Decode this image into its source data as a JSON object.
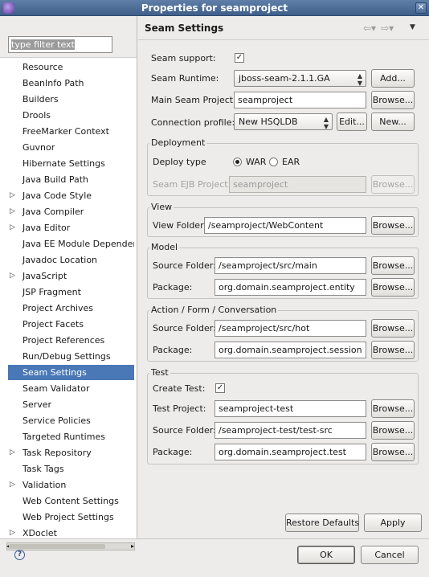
{
  "window": {
    "title": "Properties for seamproject",
    "close_glyph": "✕"
  },
  "filter": {
    "value": "type filter text"
  },
  "tree": {
    "items": [
      {
        "label": "Resource",
        "expandable": false
      },
      {
        "label": "BeanInfo Path",
        "expandable": false
      },
      {
        "label": "Builders",
        "expandable": false
      },
      {
        "label": "Drools",
        "expandable": false
      },
      {
        "label": "FreeMarker Context",
        "expandable": false
      },
      {
        "label": "Guvnor",
        "expandable": false
      },
      {
        "label": "Hibernate Settings",
        "expandable": false
      },
      {
        "label": "Java Build Path",
        "expandable": false
      },
      {
        "label": "Java Code Style",
        "expandable": true
      },
      {
        "label": "Java Compiler",
        "expandable": true
      },
      {
        "label": "Java Editor",
        "expandable": true
      },
      {
        "label": "Java EE Module Dependencies",
        "expandable": false
      },
      {
        "label": "Javadoc Location",
        "expandable": false
      },
      {
        "label": "JavaScript",
        "expandable": true
      },
      {
        "label": "JSP Fragment",
        "expandable": false
      },
      {
        "label": "Project Archives",
        "expandable": false
      },
      {
        "label": "Project Facets",
        "expandable": false
      },
      {
        "label": "Project References",
        "expandable": false
      },
      {
        "label": "Run/Debug Settings",
        "expandable": false
      },
      {
        "label": "Seam Settings",
        "expandable": false,
        "selected": true
      },
      {
        "label": "Seam Validator",
        "expandable": false
      },
      {
        "label": "Server",
        "expandable": false
      },
      {
        "label": "Service Policies",
        "expandable": false
      },
      {
        "label": "Targeted Runtimes",
        "expandable": false
      },
      {
        "label": "Task Repository",
        "expandable": true
      },
      {
        "label": "Task Tags",
        "expandable": false
      },
      {
        "label": "Validation",
        "expandable": true
      },
      {
        "label": "Web Content Settings",
        "expandable": false
      },
      {
        "label": "Web Project Settings",
        "expandable": false
      },
      {
        "label": "XDoclet",
        "expandable": true
      }
    ]
  },
  "panel": {
    "title": "Seam Settings",
    "seam_support_label": "Seam support:",
    "seam_runtime_label": "Seam Runtime:",
    "seam_runtime_value": "jboss-seam-2.1.1.GA",
    "add_label": "Add...",
    "main_project_label": "Main Seam Project:",
    "main_project_value": "seamproject",
    "browse_label": "Browse...",
    "conn_profile_label": "Connection profile:",
    "conn_profile_value": "New HSQLDB",
    "edit_label": "Edit...",
    "new_label": "New...",
    "deployment": {
      "title": "Deployment",
      "deploy_type_label": "Deploy type",
      "war_label": "WAR",
      "ear_label": "EAR",
      "ejb_label": "Seam EJB Project:",
      "ejb_value": "seamproject"
    },
    "view": {
      "title": "View",
      "folder_label": "View Folder:",
      "folder_value": "/seamproject/WebContent"
    },
    "model": {
      "title": "Model",
      "source_label": "Source Folder:",
      "source_value": "/seamproject/src/main",
      "package_label": "Package:",
      "package_value": "org.domain.seamproject.entity"
    },
    "action": {
      "title": "Action / Form / Conversation",
      "source_label": "Source Folder:",
      "source_value": "/seamproject/src/hot",
      "package_label": "Package:",
      "package_value": "org.domain.seamproject.session"
    },
    "test": {
      "title": "Test",
      "create_label": "Create Test:",
      "project_label": "Test Project:",
      "project_value": "seamproject-test",
      "source_label": "Source Folder:",
      "source_value": "/seamproject-test/test-src",
      "package_label": "Package:",
      "package_value": "org.domain.seamproject.test"
    },
    "restore_defaults": "Restore Defaults",
    "apply": "Apply"
  },
  "footer": {
    "ok": "OK",
    "cancel": "Cancel",
    "help_glyph": "?"
  }
}
